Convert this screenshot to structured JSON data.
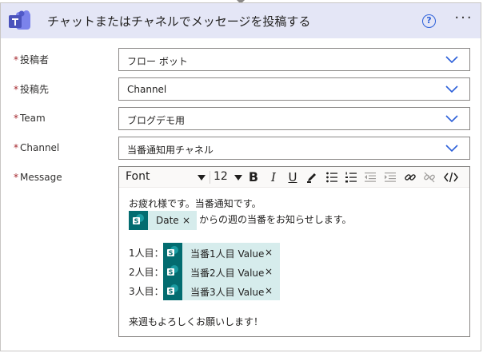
{
  "header": {
    "title": "チャットまたはチャネルでメッセージを投稿する",
    "help_glyph": "?",
    "more_glyph": "···"
  },
  "fields": {
    "poster": {
      "label": "投稿者",
      "value": "フロー ボット"
    },
    "post_in": {
      "label": "投稿先",
      "value": "Channel"
    },
    "team": {
      "label": "Team",
      "value": "ブログデモ用"
    },
    "channel": {
      "label": "Channel",
      "value": "当番通知用チャネル"
    },
    "message": {
      "label": "Message"
    }
  },
  "required_mark": "*",
  "toolbar": {
    "font": "Font",
    "size": "12",
    "bold": "B",
    "italic": "I",
    "underline": "U"
  },
  "message": {
    "line1": "お疲れ様です。当番通知です。",
    "date_token": "Date",
    "line2_suffix": "からの週の当番をお知らせします。",
    "row1_label": "1人目：",
    "row2_label": "2人目：",
    "row3_label": "3人目：",
    "token1": "当番1人目 Value",
    "token2": "当番2人目 Value",
    "token3": "当番3人目 Value",
    "closing": "来週もよろしくお願いします！",
    "token_close": "×"
  },
  "colors": {
    "header_bg": "#e4e6f6",
    "teams_purple": "#5059c9",
    "sharepoint_teal": "#036c70",
    "token_bg": "#d6ecec",
    "required_red": "#a4262c",
    "chevron_blue": "#2b5fd9"
  }
}
